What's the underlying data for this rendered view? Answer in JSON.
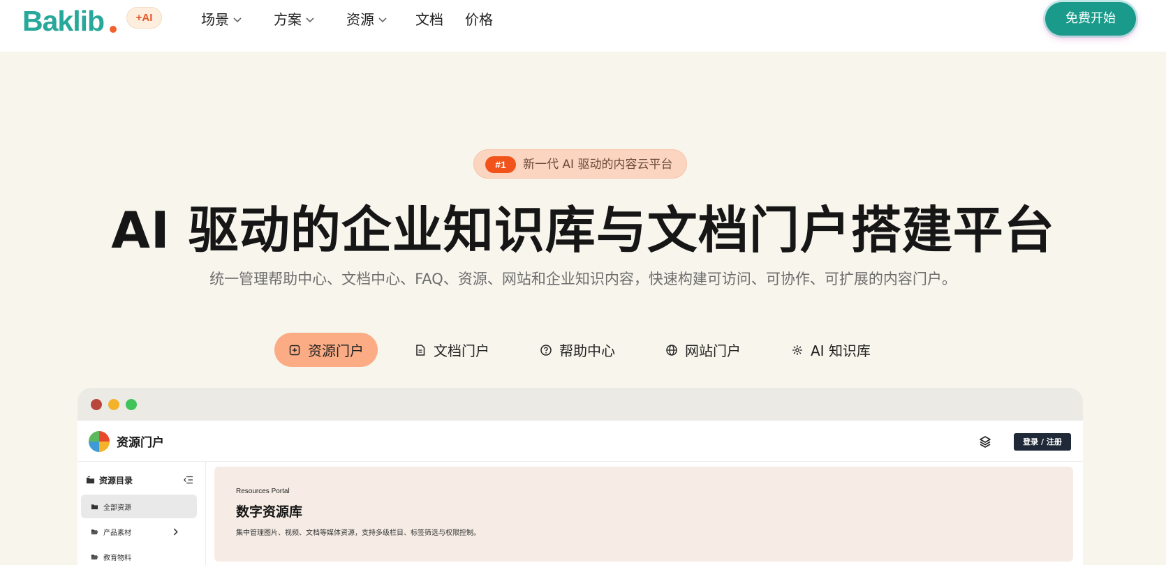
{
  "header": {
    "logo_text": "Baklib",
    "ai_badge": "+AI",
    "nav": [
      {
        "label": "场景",
        "has_dropdown": true
      },
      {
        "label": "方案",
        "has_dropdown": true
      },
      {
        "label": "资源",
        "has_dropdown": true
      },
      {
        "label": "文档",
        "has_dropdown": false
      },
      {
        "label": "价格",
        "has_dropdown": false
      }
    ],
    "cta_label": "免费开始"
  },
  "hero": {
    "pill_tag": "#1",
    "pill_text": "新一代 AI 驱动的内容云平台",
    "title": "AI 驱动的企业知识库与文档门户搭建平台",
    "subtitle": "统一管理帮助中心、文档中心、FAQ、资源、网站和企业知识内容，快速构建可访问、可协作、可扩展的内容门户。"
  },
  "tabs": [
    {
      "label": "资源门户",
      "icon": "plus-square-icon",
      "active": true
    },
    {
      "label": "文档门户",
      "icon": "document-icon",
      "active": false
    },
    {
      "label": "帮助中心",
      "icon": "question-circle-icon",
      "active": false
    },
    {
      "label": "网站门户",
      "icon": "globe-icon",
      "active": false
    },
    {
      "label": "AI 知识库",
      "icon": "sparkle-icon",
      "active": false
    }
  ],
  "preview": {
    "window_dots": [
      "#b8463a",
      "#f2b32a",
      "#3fc35a"
    ],
    "app_title": "资源门户",
    "login_label": "登录 / 注册",
    "sidebar": {
      "heading": "资源目录",
      "items": [
        {
          "label": "全部资源",
          "active": true,
          "has_children": false
        },
        {
          "label": "产品素材",
          "active": false,
          "has_children": true
        },
        {
          "label": "教育物料",
          "active": false,
          "has_children": false
        }
      ]
    },
    "banner": {
      "kicker": "Resources Portal",
      "title": "数字资源库",
      "description": "集中管理图片、视频、文档等媒体资源，支持多级栏目、标签筛选与权限控制。"
    }
  },
  "colors": {
    "brand": "#27a89a",
    "cta": "#1a9a8b",
    "accent_orange": "#f1531a",
    "active_tab": "#fbac84",
    "page_bg": "#f7f5ec"
  }
}
